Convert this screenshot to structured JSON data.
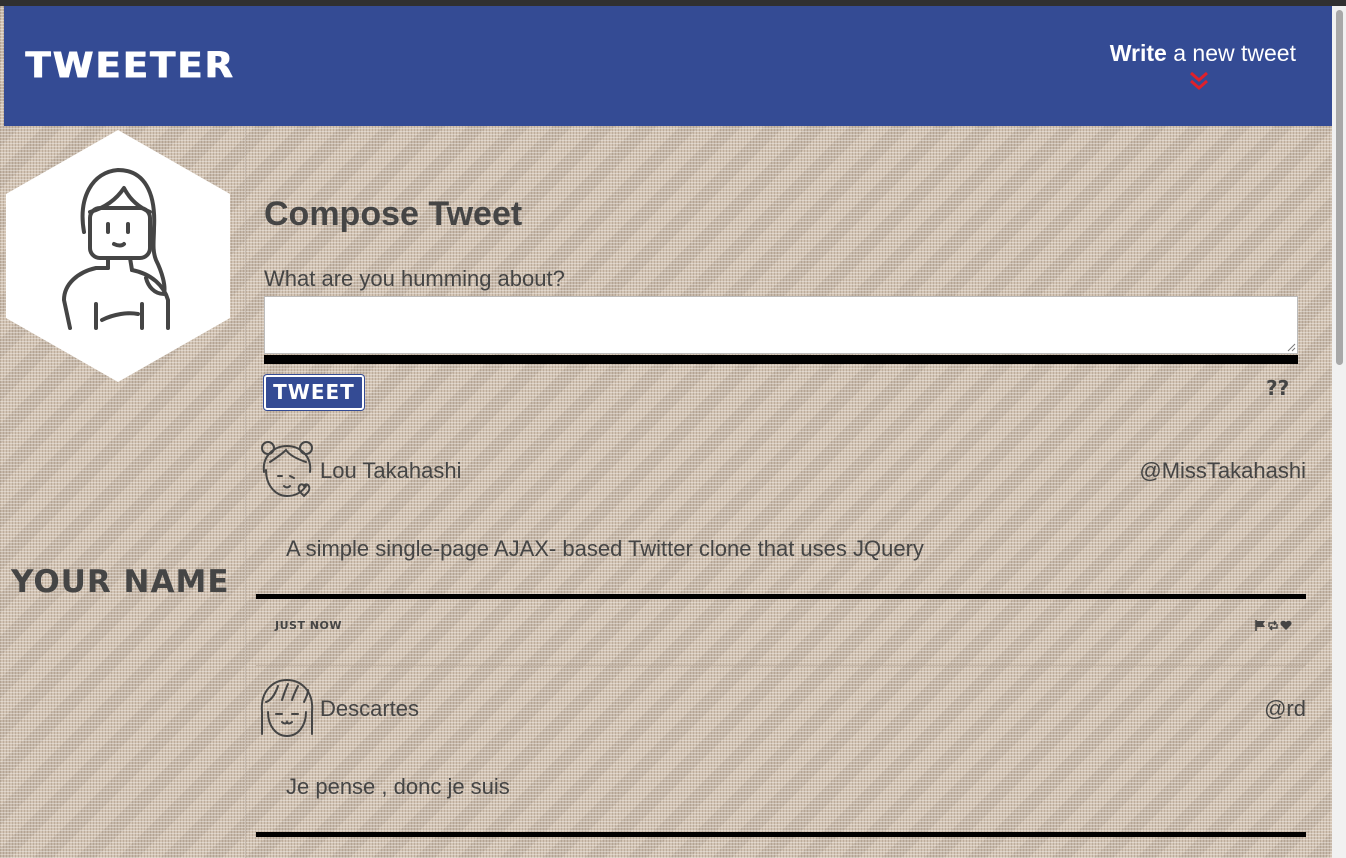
{
  "nav": {
    "brand": "TWEETER",
    "write_bold": "Write",
    "write_rest": " a new tweet",
    "chevron_icon": "double-chevron-down-icon",
    "chevron_color": "#e0202a",
    "background": "#344b94"
  },
  "profile": {
    "avatar_icon": "woman-avatar-icon",
    "name": "YOUR NAME"
  },
  "compose": {
    "title": "Compose Tweet",
    "label": "What are you humming about?",
    "value": "",
    "button_label": "TWEET",
    "counter": "??"
  },
  "tweets": [
    {
      "avatar_icon": "girl-avatar-icon",
      "name": "Lou Takahashi",
      "handle": "@MissTakahashi",
      "text": "A simple single-page AJAX- based Twitter clone that uses JQuery",
      "time": "JUST NOW",
      "actions": [
        "flag-icon",
        "retweet-icon",
        "heart-icon"
      ]
    },
    {
      "avatar_icon": "boy-avatar-icon",
      "name": "Descartes",
      "handle": "@rd",
      "text": "Je pense , donc je suis",
      "time": "",
      "actions": []
    }
  ]
}
